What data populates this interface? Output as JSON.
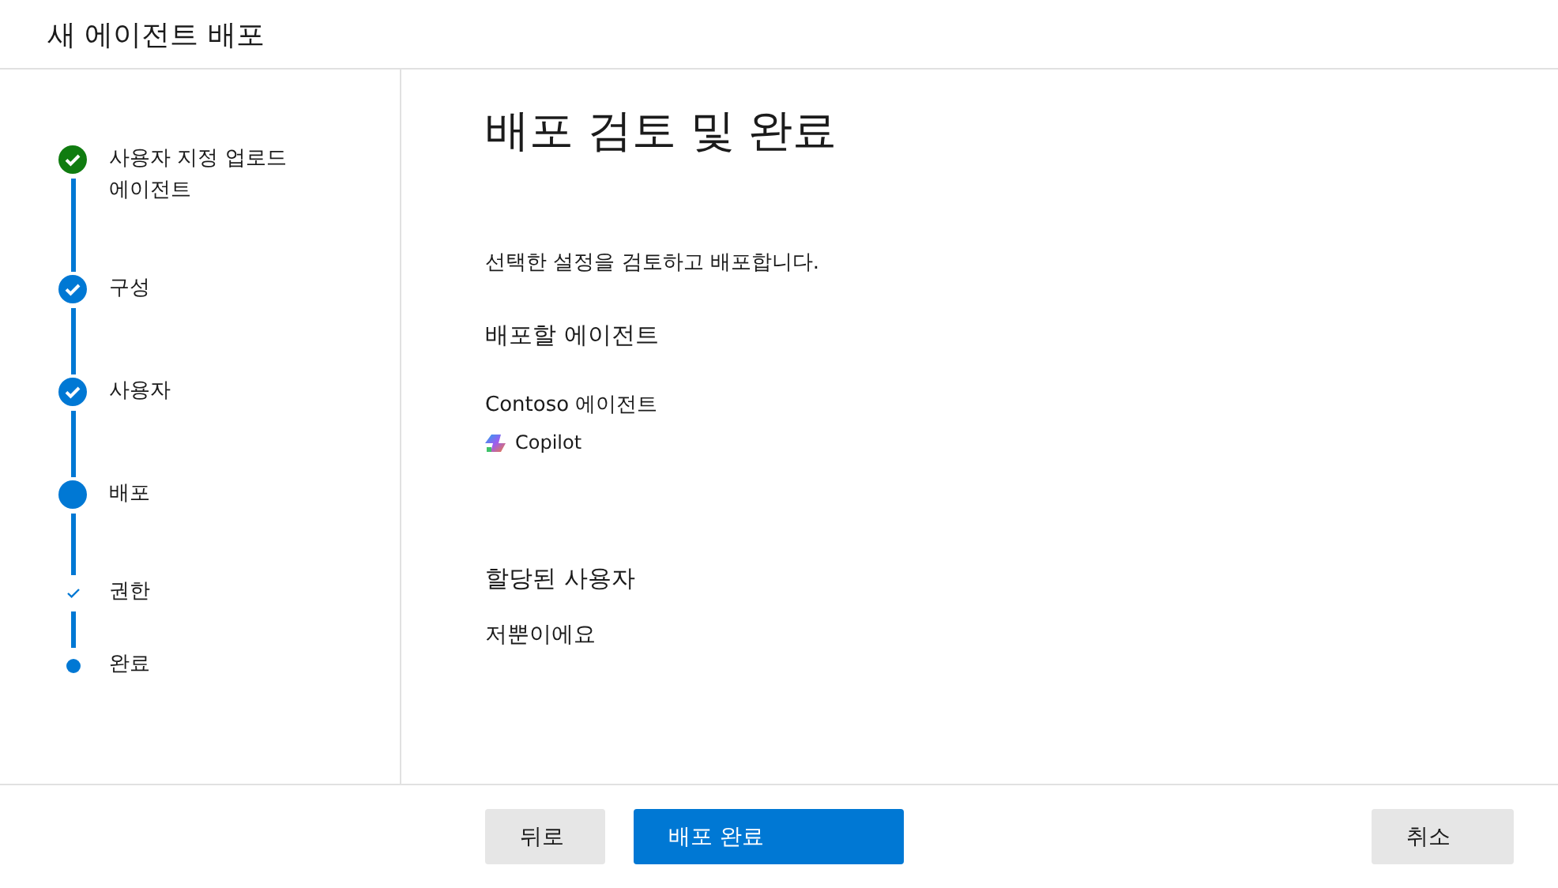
{
  "window": {
    "title": "새 에이전트 배포"
  },
  "steps": [
    {
      "label": "사용자 지정 업로드 에이전트",
      "kind": "completed",
      "color": "#107c10"
    },
    {
      "label": "구성",
      "kind": "completed",
      "color": "#0078d4"
    },
    {
      "label": "사용자",
      "kind": "completed",
      "color": "#0078d4"
    },
    {
      "label": "배포",
      "kind": "current",
      "color": "#0078d4"
    },
    {
      "label": "권한",
      "kind": "substep",
      "color": "#0078d4"
    },
    {
      "label": "완료",
      "kind": "pending",
      "color": "#0078d4"
    }
  ],
  "main": {
    "heading": "배포 검토 및 완료",
    "description": "선택한 설정을 검토하고 배포합니다.",
    "agent_section": {
      "title": "배포할 에이전트",
      "agent_name": "Contoso 에이전트",
      "platform": "Copilot"
    },
    "users_section": {
      "title": "할당된 사용자",
      "value": "저뿐이에요"
    }
  },
  "footer": {
    "back": "뒤로",
    "primary": "배포 완료",
    "cancel": "취소"
  }
}
